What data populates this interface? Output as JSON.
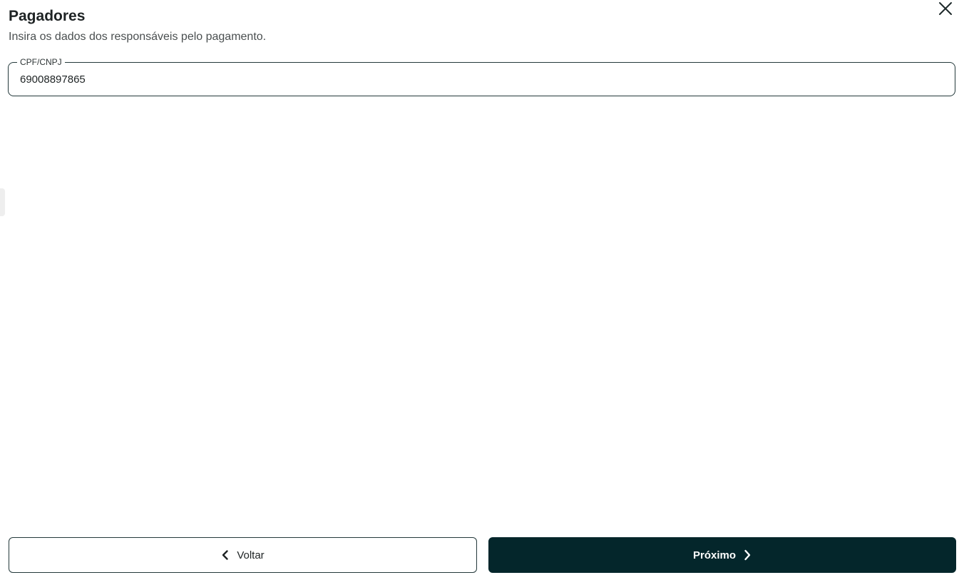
{
  "header": {
    "title": "Pagadores",
    "subtitle": "Insira os dados dos responsáveis pelo pagamento."
  },
  "icons": {
    "close": "close-icon",
    "back": "chevron-left-icon",
    "next": "chevron-right-icon"
  },
  "form": {
    "cpf_cnpj": {
      "label": "CPF/CNPJ",
      "value": "69008897865"
    }
  },
  "footer": {
    "back_label": "Voltar",
    "next_label": "Próximo"
  },
  "colors": {
    "primary": "#04262b",
    "border": "#24393b",
    "text": "#1e2324"
  }
}
